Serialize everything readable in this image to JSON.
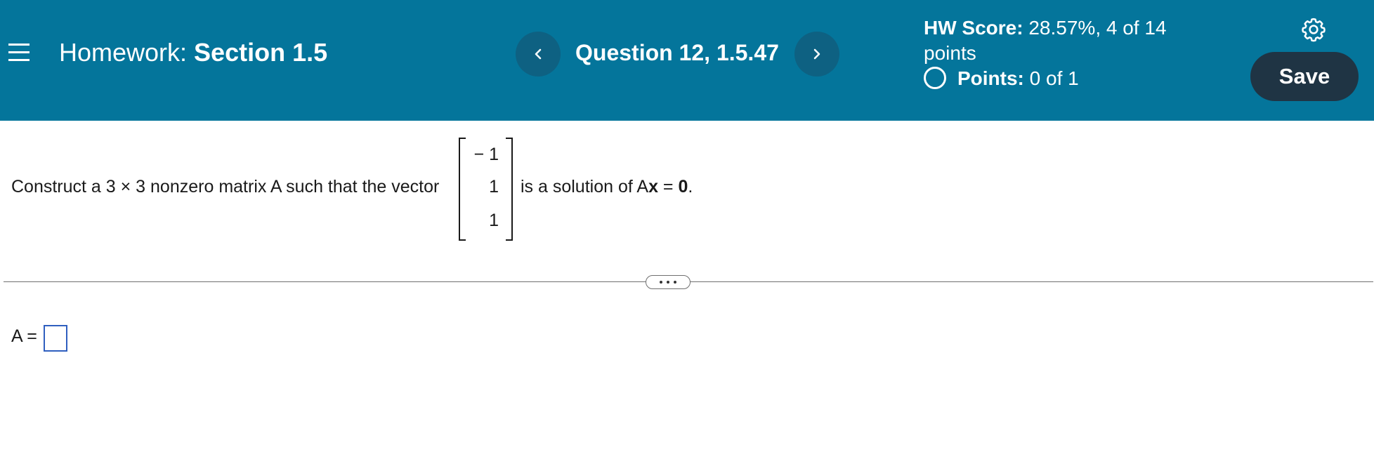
{
  "header": {
    "homework_label": "Homework:",
    "section": "Section 1.5",
    "question": "Question 12, 1.5.47",
    "hw_score_label": "HW Score:",
    "hw_score_value": "28.57%, 4 of 14",
    "hw_score_value_cont": "points",
    "points_label": "Points:",
    "points_value": "0 of 1",
    "save_label": "Save",
    "colors": {
      "header_bg": "#04759b",
      "nav_button": "#0e6182",
      "save_button": "#1f3444"
    },
    "icons": [
      "menu-icon",
      "chevron-left-icon",
      "chevron-right-icon",
      "circle-icon",
      "gear-icon"
    ]
  },
  "question": {
    "prefix": "Construct a 3 × 3 nonzero matrix A such that the vector",
    "vector": [
      "− 1",
      "1",
      "1"
    ],
    "suffix_start": "is a solution of A",
    "suffix_bold": "x",
    "suffix_eq": " = ",
    "suffix_zero": "0",
    "suffix_end": "."
  },
  "answer": {
    "label": "A ="
  }
}
